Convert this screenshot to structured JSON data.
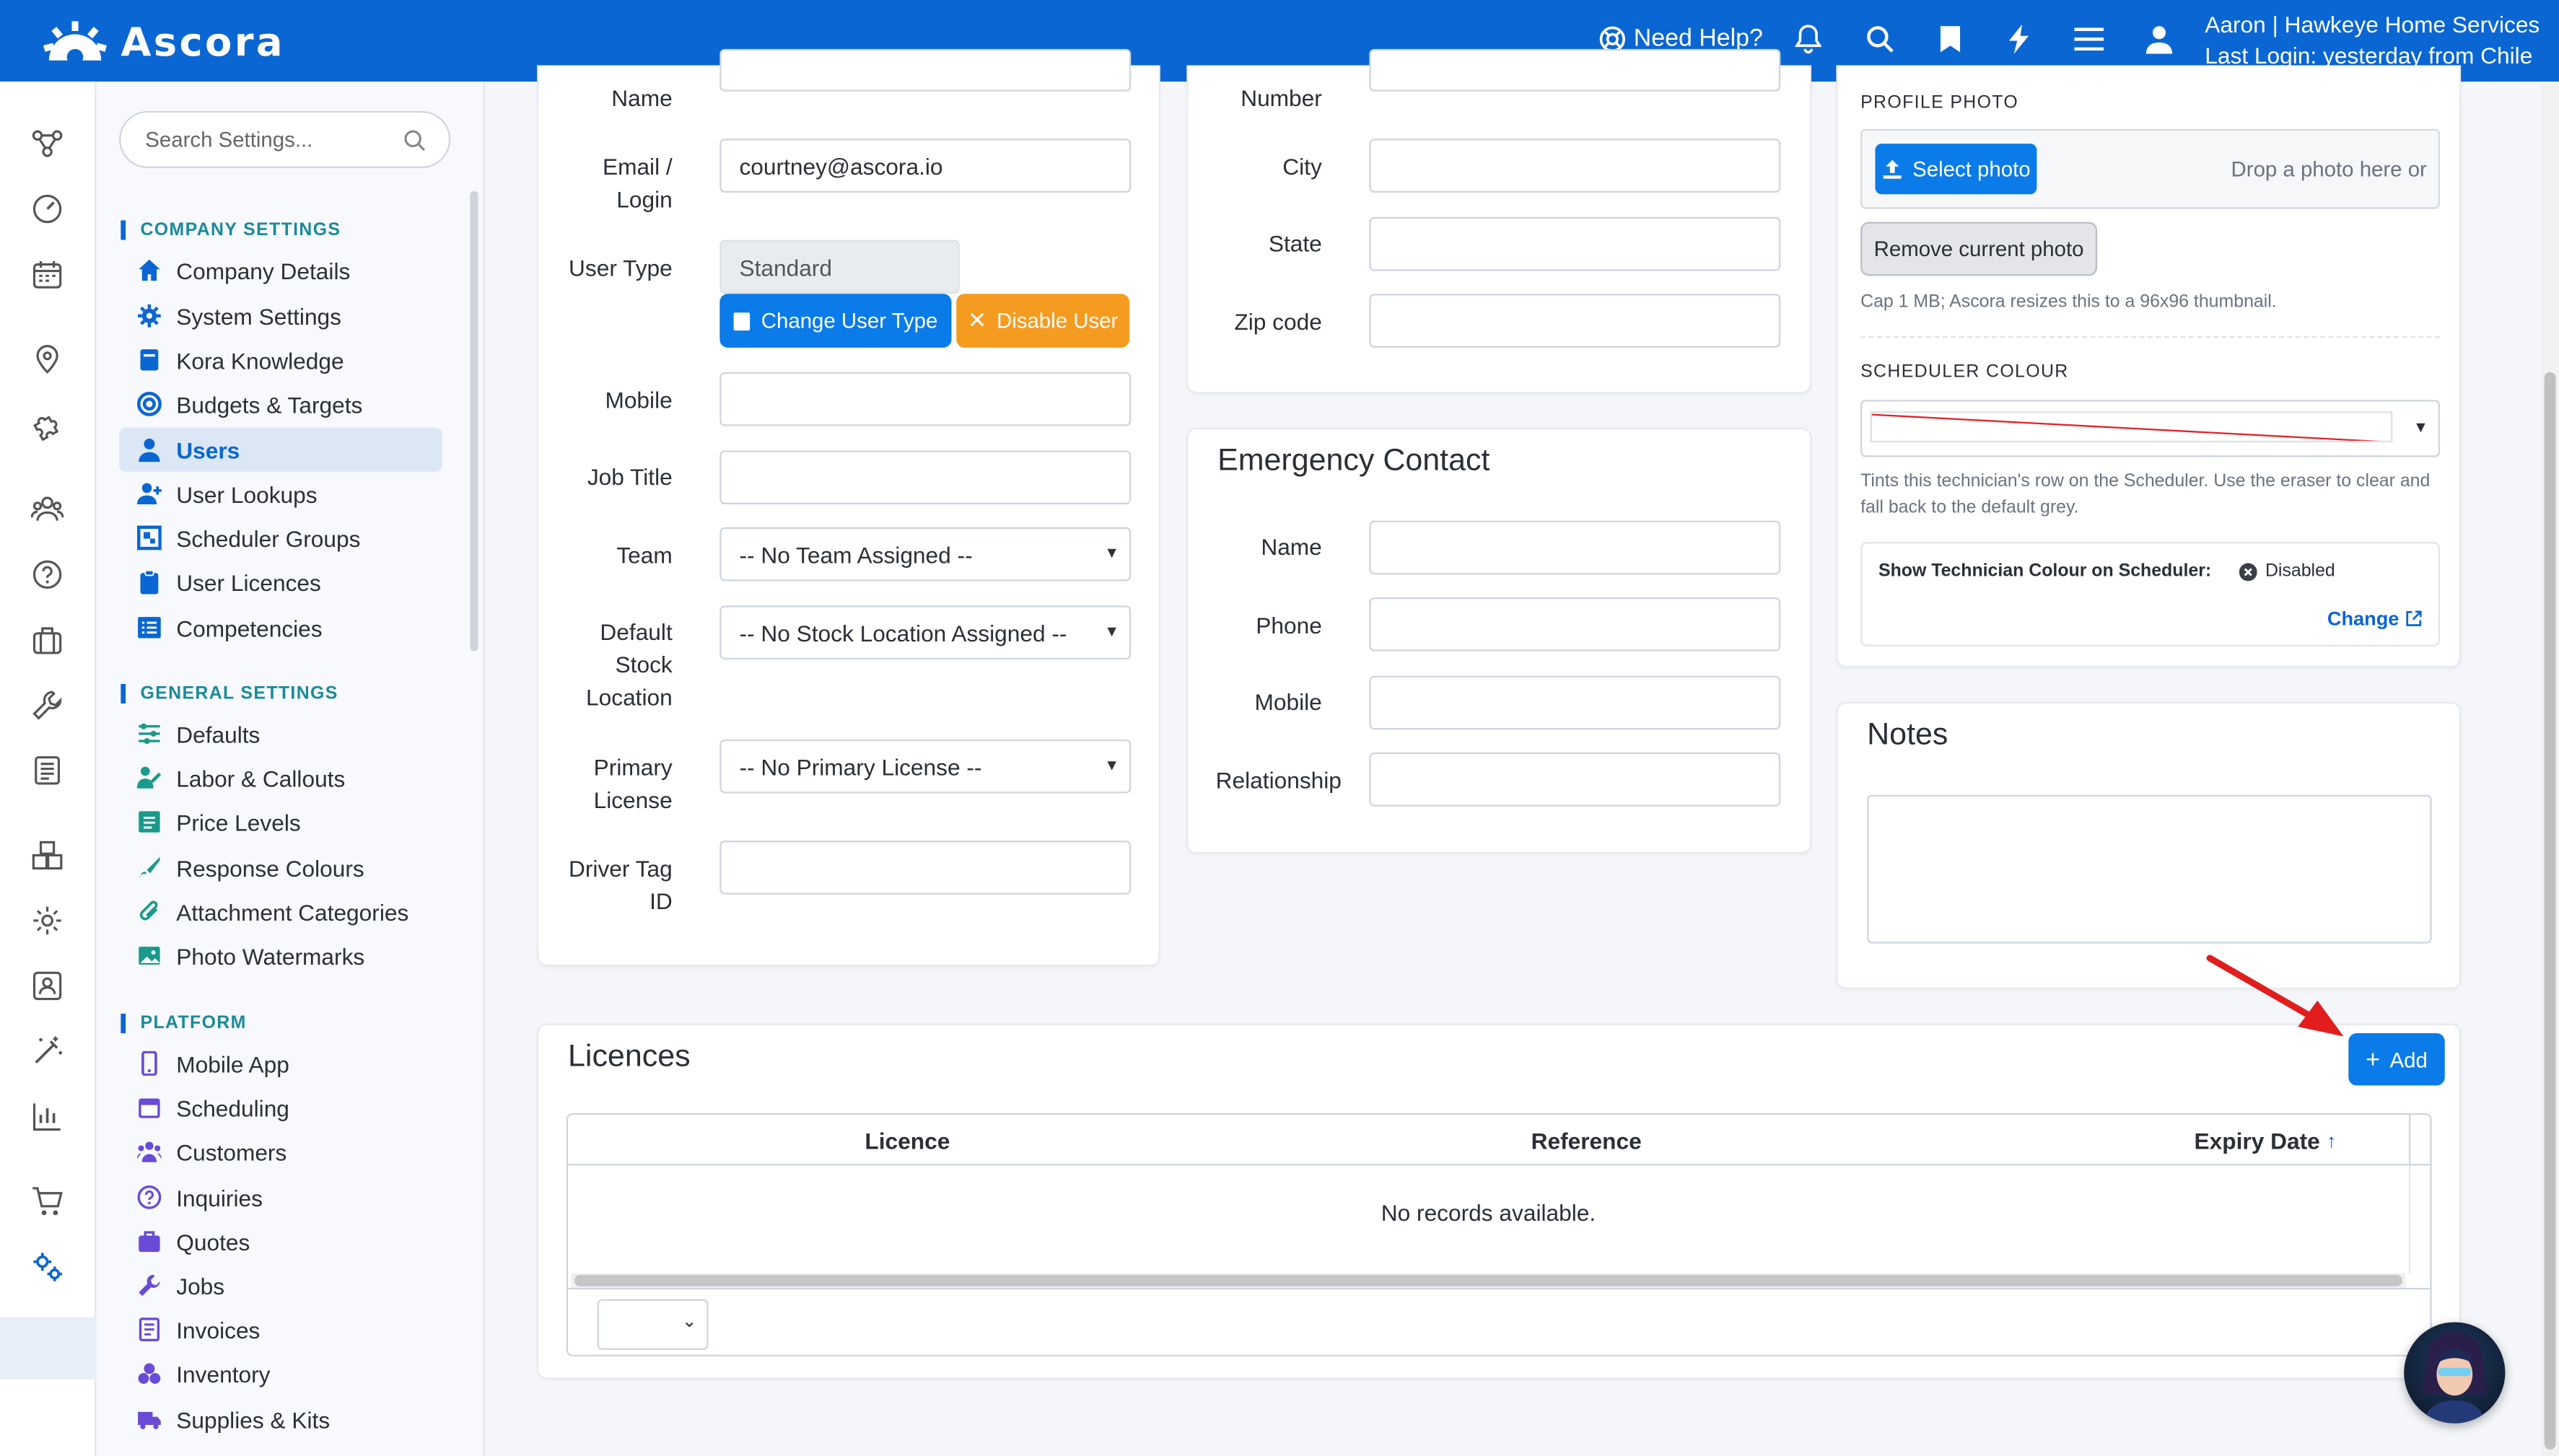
{
  "brand": {
    "name": "Ascora"
  },
  "topbar": {
    "help_label": "Need Help?",
    "user_line1": "Aaron | Hawkeye Home Services",
    "user_line2": "Last Login: yesterday from Chile"
  },
  "settings_nav": {
    "search_placeholder": "Search Settings...",
    "sections": [
      {
        "title": "COMPANY SETTINGS",
        "items": [
          "Company Details",
          "System Settings",
          "Kora Knowledge",
          "Budgets & Targets",
          "Users",
          "User Lookups",
          "Scheduler Groups",
          "User Licences",
          "Competencies"
        ]
      },
      {
        "title": "GENERAL SETTINGS",
        "items": [
          "Defaults",
          "Labor & Callouts",
          "Price Levels",
          "Response Colours",
          "Attachment Categories",
          "Photo Watermarks"
        ]
      },
      {
        "title": "PLATFORM",
        "items": [
          "Mobile App",
          "Scheduling",
          "Customers",
          "Inquiries",
          "Quotes",
          "Jobs",
          "Invoices",
          "Inventory",
          "Supplies & Kits"
        ]
      }
    ],
    "active_item": "Users"
  },
  "user_form": {
    "name_label": "Name",
    "email_label": "Email / Login",
    "email_value": "courtney@ascora.io",
    "user_type_label": "User Type",
    "user_type_value": "Standard",
    "change_user_type_label": "Change User Type",
    "disable_user_label": "Disable User",
    "mobile_label": "Mobile",
    "job_title_label": "Job Title",
    "team_label": "Team",
    "team_value": "-- No Team Assigned --",
    "stock_location_label": "Default Stock Location",
    "stock_location_value": "-- No Stock Location Assigned --",
    "primary_license_label": "Primary License",
    "primary_license_value": "-- No Primary License --",
    "driver_tag_label": "Driver Tag ID"
  },
  "address_form": {
    "number_label": "Number",
    "city_label": "City",
    "state_label": "State",
    "zip_label": "Zip code"
  },
  "emergency_contact": {
    "title": "Emergency Contact",
    "name_label": "Name",
    "phone_label": "Phone",
    "mobile_label": "Mobile",
    "relationship_label": "Relationship"
  },
  "profile": {
    "photo_caption": "PROFILE PHOTO",
    "select_photo_label": "Select photo",
    "drop_text": "Drop a photo here or",
    "remove_photo_label": "Remove current photo",
    "photo_hint": "Cap 1 MB; Ascora resizes this to a 96x96 thumbnail.",
    "scheduler_colour_caption": "SCHEDULER COLOUR",
    "scheduler_colour_hint": "Tints this technician's row on the Scheduler. Use the eraser to clear and fall back to the default grey.",
    "show_colour_label": "Show Technician Colour on Scheduler:",
    "show_colour_status": "Disabled",
    "change_label": "Change"
  },
  "notes": {
    "title": "Notes"
  },
  "licences": {
    "title": "Licences",
    "add_label": "Add",
    "columns": [
      "Licence",
      "Reference",
      "Expiry Date"
    ],
    "empty_text": "No records available."
  },
  "colors": {
    "brand_blue": "#0a66d2",
    "button_blue": "#0a7be8",
    "orange": "#f59b1f",
    "annotation_arrow": "#e11d1d"
  }
}
